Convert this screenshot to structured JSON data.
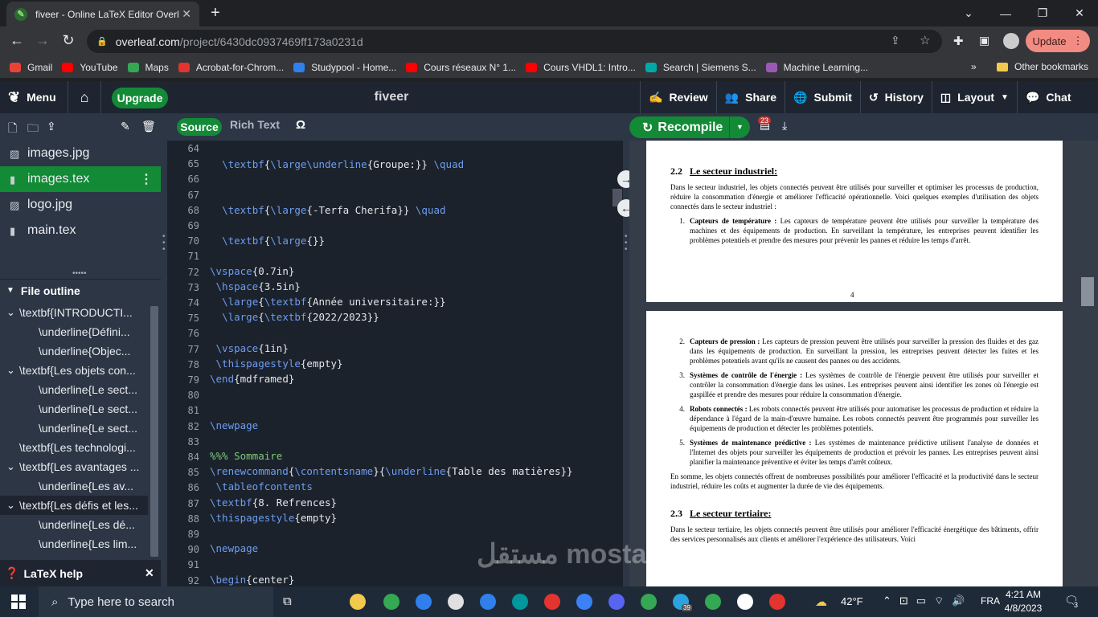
{
  "browser": {
    "tab_title": "fiveer - Online LaTeX Editor Overl",
    "url_host": "overleaf.com",
    "url_path": "/project/6430dc0937469ff173a0231d",
    "update_label": "Update"
  },
  "bookmarks": [
    {
      "label": "Gmail",
      "color": "#ea4335"
    },
    {
      "label": "YouTube",
      "color": "#ff0000"
    },
    {
      "label": "Maps",
      "color": "#34a853"
    },
    {
      "label": "Acrobat-for-Chrom...",
      "color": "#e3342f"
    },
    {
      "label": "Studypool - Home...",
      "color": "#2f80ed"
    },
    {
      "label": "Cours réseaux N° 1...",
      "color": "#ff0000"
    },
    {
      "label": "Cours VHDL1: Intro...",
      "color": "#ff0000"
    },
    {
      "label": "Search | Siemens S...",
      "color": "#00a8a8"
    },
    {
      "label": "Machine Learning...",
      "color": "#9b59b6"
    }
  ],
  "other_bookmarks": "Other bookmarks",
  "toolbar": {
    "menu": "Menu",
    "upgrade": "Upgrade",
    "project_name": "fiveer",
    "review": "Review",
    "share": "Share",
    "submit": "Submit",
    "history": "History",
    "layout": "Layout",
    "chat": "Chat"
  },
  "files": [
    {
      "name": "images.jpg",
      "icon": "image-icon",
      "active": false
    },
    {
      "name": "images.tex",
      "icon": "doc-icon",
      "active": true
    },
    {
      "name": "logo.jpg",
      "icon": "image-icon",
      "active": false
    },
    {
      "name": "main.tex",
      "icon": "doc-icon",
      "active": false
    }
  ],
  "outline": {
    "title": "File outline",
    "items": [
      {
        "label": "\\textbf{INTRODUCTI...",
        "indent": 0,
        "arrow": true,
        "selected": false
      },
      {
        "label": "\\underline{Défini...",
        "indent": 1,
        "arrow": false,
        "selected": false
      },
      {
        "label": "\\underline{Objec...",
        "indent": 1,
        "arrow": false,
        "selected": false
      },
      {
        "label": "\\textbf{Les objets con...",
        "indent": 0,
        "arrow": true,
        "selected": false
      },
      {
        "label": "\\underline{Le sect...",
        "indent": 1,
        "arrow": false,
        "selected": false
      },
      {
        "label": "\\underline{Le sect...",
        "indent": 1,
        "arrow": false,
        "selected": false
      },
      {
        "label": "\\underline{Le sect...",
        "indent": 1,
        "arrow": false,
        "selected": false
      },
      {
        "label": "\\textbf{Les technologi...",
        "indent": 0,
        "arrow": false,
        "selected": false
      },
      {
        "label": "\\textbf{Les avantages ...",
        "indent": 0,
        "arrow": true,
        "selected": false
      },
      {
        "label": "\\underline{Les av...",
        "indent": 1,
        "arrow": false,
        "selected": false
      },
      {
        "label": "\\textbf{Les défis et les...",
        "indent": 0,
        "arrow": true,
        "selected": true
      },
      {
        "label": "\\underline{Les dé...",
        "indent": 1,
        "arrow": false,
        "selected": false
      },
      {
        "label": "\\underline{Les lim...",
        "indent": 1,
        "arrow": false,
        "selected": false
      }
    ]
  },
  "latex_help": "LaTeX help",
  "editor": {
    "source_tab": "Source",
    "rich_text_tab": "Rich Text",
    "symbol_button": "Ω",
    "line_numbers": [
      "64",
      "65",
      "66",
      "67",
      "68",
      "69",
      "70",
      "71",
      "72",
      "73",
      "74",
      "75",
      "76",
      "77",
      "78",
      "79",
      "80",
      "81",
      "82",
      "83",
      "84",
      "85",
      "86",
      "87",
      "88",
      "89",
      "90",
      "91",
      "92"
    ]
  },
  "pdf": {
    "recompile": "Recompile",
    "badge": "23",
    "page1": {
      "heading_num": "2.2",
      "heading": "Le secteur industriel:",
      "intro": "Dans le secteur industriel, les objets connectés peuvent être utilisés pour surveiller et optimiser les processus de production, réduire la consommation d'énergie et améliorer l'efficacité opérationnelle. Voici quelques exemples d'utilisation des objets connectés dans le secteur industriel :",
      "item1_num": "1.",
      "item1_bold": "Capteurs de température :",
      "item1_text": "Les capteurs de température peuvent être utilisés pour surveiller la température des machines et des équipements de production. En surveillant la température, les entreprises peuvent identifier les problèmes potentiels et prendre des mesures pour prévenir les pannes et réduire les temps d'arrêt.",
      "page_number": "4"
    },
    "page2": {
      "items": [
        {
          "num": "2.",
          "bold": "Capteurs de pression :",
          "text": "Les capteurs de pression peuvent être utilisés pour surveiller la pression des fluides et des gaz dans les équipements de production. En surveillant la pression, les entreprises peuvent détecter les fuites et les problèmes potentiels avant qu'ils ne causent des pannes ou des accidents."
        },
        {
          "num": "3.",
          "bold": "Systèmes de contrôle de l'énergie :",
          "text": "Les systèmes de contrôle de l'énergie peuvent être utilisés pour surveiller et contrôler la consommation d'énergie dans les usines. Les entreprises peuvent ainsi identifier les zones où l'énergie est gaspillée et prendre des mesures pour réduire la consommation d'énergie."
        },
        {
          "num": "4.",
          "bold": "Robots connectés :",
          "text": "Les robots connectés peuvent être utilisés pour automatiser les processus de production et réduire la dépendance à l'égard de la main-d'œuvre humaine. Les robots connectés peuvent être programmés pour surveiller les équipements de production et détecter les problèmes potentiels."
        },
        {
          "num": "5.",
          "bold": "Systèmes de maintenance prédictive :",
          "text": "Les systèmes de maintenance prédictive utilisent l'analyse de données et l'Internet des objets pour surveiller les équipements de production et prévoir les pannes. Les entreprises peuvent ainsi planifier la maintenance préventive et éviter les temps d'arrêt coûteux."
        }
      ],
      "summary": "En somme, les objets connectés offrent de nombreuses possibilités pour améliorer l'efficacité et la productivité dans le secteur industriel, réduire les coûts et augmenter la durée de vie des équipements.",
      "heading_num": "2.3",
      "heading": "Le secteur tertiaire:",
      "tertiaire_text": "Dans le secteur tertiaire, les objets connectés peuvent être utilisés pour améliorer l'efficacité énergétique des bâtiments, offrir des services personnalisés aux clients et améliorer l'expérience des utilisateurs. Voici"
    }
  },
  "taskbar": {
    "search_placeholder": "Type here to search",
    "temperature": "42°F",
    "language": "FRA",
    "time": "4:21 AM",
    "date": "4/8/2023",
    "badge_count": "3",
    "telegram_badge": "39"
  },
  "watermark": "مستقل mostaql.com"
}
